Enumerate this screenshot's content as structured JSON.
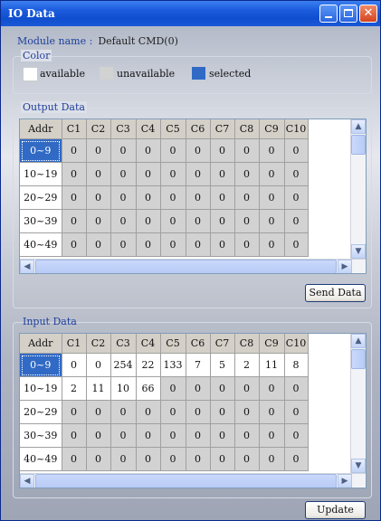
{
  "window": {
    "title": "IO Data"
  },
  "module": {
    "label": "Module name :",
    "value": "Default CMD(0)"
  },
  "color": {
    "group_label": "Color",
    "items": [
      {
        "label": "available",
        "color": "#ffffff"
      },
      {
        "label": "unavailable",
        "color": "#d2d2d2"
      },
      {
        "label": "selected",
        "color": "#316ac5"
      }
    ]
  },
  "output": {
    "group_label": "Output Data",
    "headers": [
      "Addr",
      "C1",
      "C2",
      "C3",
      "C4",
      "C5",
      "C6",
      "C7",
      "C8",
      "C9",
      "C10"
    ],
    "rows": [
      {
        "addr": "0~9",
        "values": [
          "0",
          "0",
          "0",
          "0",
          "0",
          "0",
          "0",
          "0",
          "0",
          "0"
        ]
      },
      {
        "addr": "10~19",
        "values": [
          "0",
          "0",
          "0",
          "0",
          "0",
          "0",
          "0",
          "0",
          "0",
          "0"
        ]
      },
      {
        "addr": "20~29",
        "values": [
          "0",
          "0",
          "0",
          "0",
          "0",
          "0",
          "0",
          "0",
          "0",
          "0"
        ]
      },
      {
        "addr": "30~39",
        "values": [
          "0",
          "0",
          "0",
          "0",
          "0",
          "0",
          "0",
          "0",
          "0",
          "0"
        ]
      },
      {
        "addr": "40~49",
        "values": [
          "0",
          "0",
          "0",
          "0",
          "0",
          "0",
          "0",
          "0",
          "0",
          "0"
        ]
      }
    ],
    "button": "Send Data"
  },
  "input": {
    "group_label": "Input Data",
    "headers": [
      "Addr",
      "C1",
      "C2",
      "C3",
      "C4",
      "C5",
      "C6",
      "C7",
      "C8",
      "C9",
      "C10"
    ],
    "rows": [
      {
        "addr": "0~9",
        "values": [
          "0",
          "0",
          "254",
          "22",
          "133",
          "7",
          "5",
          "2",
          "11",
          "8"
        ]
      },
      {
        "addr": "10~19",
        "values": [
          "2",
          "11",
          "10",
          "66",
          "0",
          "0",
          "0",
          "0",
          "0",
          "0"
        ]
      },
      {
        "addr": "20~29",
        "values": [
          "0",
          "0",
          "0",
          "0",
          "0",
          "0",
          "0",
          "0",
          "0",
          "0"
        ]
      },
      {
        "addr": "30~39",
        "values": [
          "0",
          "0",
          "0",
          "0",
          "0",
          "0",
          "0",
          "0",
          "0",
          "0"
        ]
      },
      {
        "addr": "40~49",
        "values": [
          "0",
          "0",
          "0",
          "0",
          "0",
          "0",
          "0",
          "0",
          "0",
          "0"
        ]
      }
    ],
    "available_cells": [
      [
        0,
        0
      ],
      [
        0,
        1
      ],
      [
        0,
        2
      ],
      [
        0,
        3
      ],
      [
        0,
        4
      ],
      [
        0,
        5
      ],
      [
        0,
        6
      ],
      [
        0,
        7
      ],
      [
        0,
        8
      ],
      [
        0,
        9
      ],
      [
        1,
        0
      ],
      [
        1,
        1
      ],
      [
        1,
        2
      ],
      [
        1,
        3
      ]
    ],
    "button": "Update"
  },
  "selected_row": 0
}
